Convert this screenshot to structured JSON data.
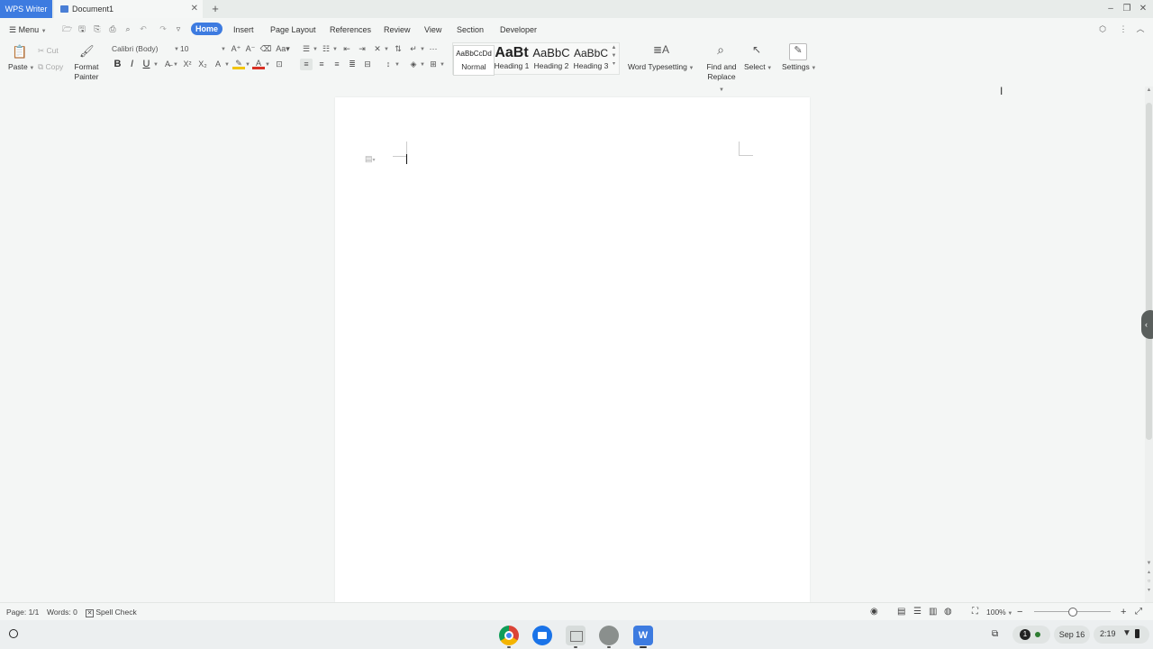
{
  "window": {
    "app_name": "WPS Writer",
    "doc_tab": "Document1",
    "new_tab": "+"
  },
  "menu": {
    "menu_label": "Menu",
    "tabs": [
      "Home",
      "Insert",
      "Page Layout",
      "References",
      "Review",
      "View",
      "Section",
      "Developer"
    ]
  },
  "ribbon": {
    "paste": "Paste",
    "cut": "Cut",
    "copy": "Copy",
    "format_painter_1": "Format",
    "format_painter_2": "Painter",
    "font_name": "Calibri (Body)",
    "font_size": "10",
    "bold": "B",
    "italic": "I",
    "underline": "U",
    "styles": [
      {
        "preview": "AaBbCcDd",
        "name": "Normal"
      },
      {
        "preview": "AaBt",
        "name": "Heading 1"
      },
      {
        "preview": "AaBbC",
        "name": "Heading 2"
      },
      {
        "preview": "AaBbC",
        "name": "Heading 3"
      }
    ],
    "word_typesetting": "Word Typesetting",
    "find_1": "Find and",
    "find_2": "Replace",
    "select": "Select",
    "settings": "Settings"
  },
  "status": {
    "page": "Page: 1/1",
    "words": "Words: 0",
    "spell_check": "Spell Check",
    "zoom": "100%",
    "zoom_minus": "−",
    "zoom_plus": "+"
  },
  "taskbar": {
    "notif_count": "1",
    "date": "Sep 16",
    "time": "2:19"
  },
  "colors": {
    "accent": "#3d7be0",
    "highlight": "#f2c400",
    "font_color": "#d93025"
  }
}
